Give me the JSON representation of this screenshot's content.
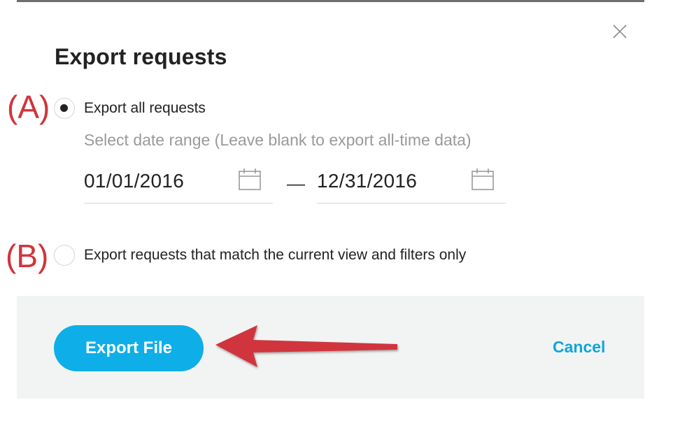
{
  "dialog": {
    "title": "Export requests",
    "close_icon": "close-icon"
  },
  "annotations": {
    "a_label": "(A)",
    "b_label": "(B)",
    "arrow_color": "#d0343c"
  },
  "options": {
    "all": {
      "label": "Export all requests",
      "selected": true
    },
    "filtered": {
      "label": "Export requests that match the current view and filters only",
      "selected": false
    }
  },
  "date_range": {
    "hint": "Select date range (Leave blank to export all-time data)",
    "start": "01/01/2016",
    "separator": "—",
    "end": "12/31/2016",
    "icon": "calendar-icon"
  },
  "footer": {
    "export_label": "Export File",
    "cancel_label": "Cancel",
    "accent_color": "#0eaee8"
  }
}
